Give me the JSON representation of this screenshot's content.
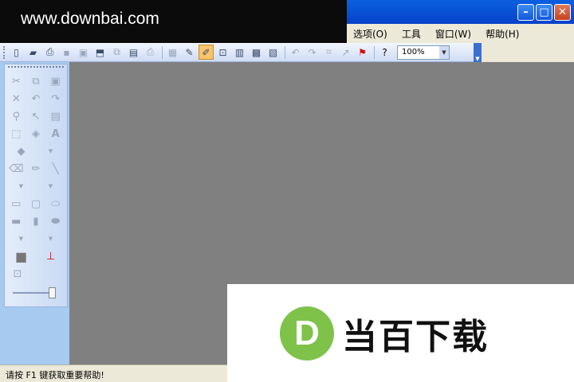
{
  "watermark": {
    "site": "www.downbai.com",
    "logo_letter": "D",
    "logo_text": "当百下载"
  },
  "window_controls": {
    "minimize": "–",
    "maximize": "□",
    "close": "✕"
  },
  "menu": {
    "items": [
      "选项(O)",
      "工具",
      "窗口(W)",
      "帮助(H)"
    ]
  },
  "toolbar": {
    "zoom_value": "100%"
  },
  "status": {
    "text": "请按 F1 键获取重要帮助!"
  },
  "icons": {
    "toolbar": [
      "new-file-icon",
      "open-icon",
      "print-preview-icon",
      "save-icon",
      "save-all-icon",
      "scan-icon",
      "copy-page-icon",
      "book-icon",
      "print-icon",
      "clipboard-icon",
      "tools-icon",
      "highlight-icon",
      "fit-icon",
      "export-icon",
      "batch-icon",
      "page-icon",
      "rotate-left-icon",
      "rotate-right-icon",
      "crop-icon",
      "send-icon",
      "flag-icon",
      "context-help-icon"
    ],
    "palette": [
      "scissors-icon",
      "copy-icon",
      "paste-icon",
      "delete-icon",
      "undo-icon",
      "redo-icon",
      "zoom-icon",
      "pointer-icon",
      "frame-icon",
      "select-rect-icon",
      "fill-icon",
      "text-icon",
      "paint-icon",
      "eraser-icon",
      "pencil-icon",
      "line-icon",
      "rectangle-icon",
      "rounded-rect-icon",
      "ellipse-icon",
      "filled-rect-icon",
      "filled-rounded-rect-icon",
      "filled-ellipse-icon",
      "color-swatch-icon",
      "stamp-icon",
      "fit-view-icon"
    ]
  }
}
